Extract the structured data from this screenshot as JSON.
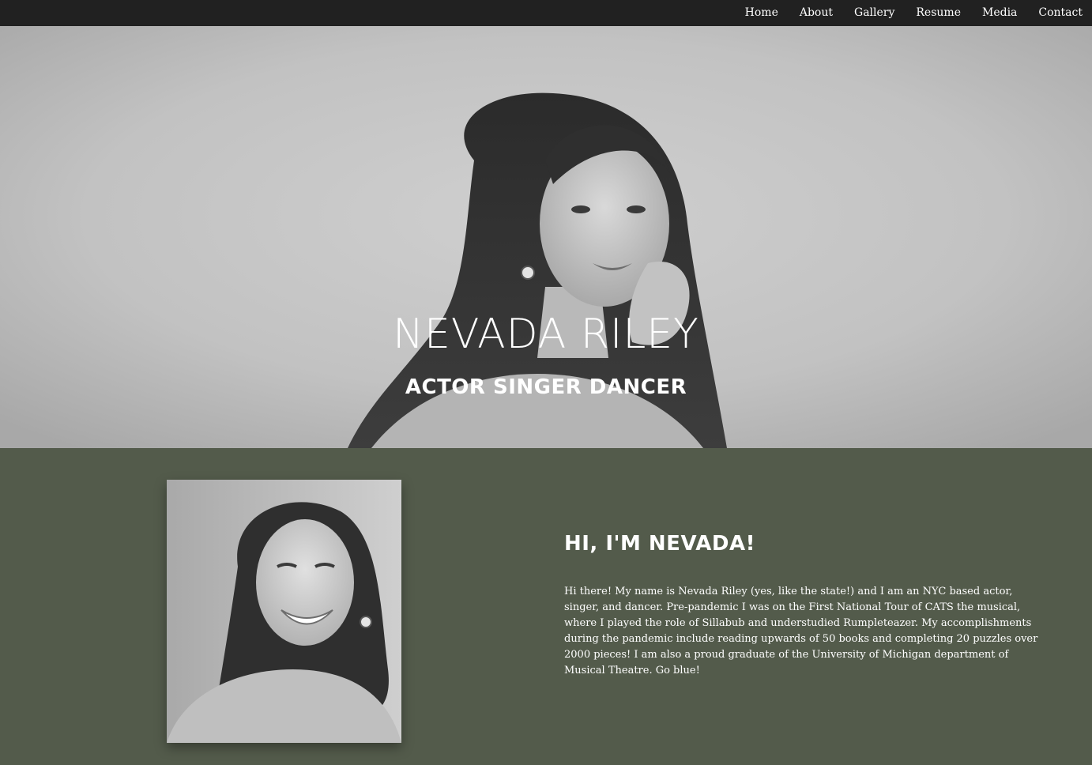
{
  "nav": {
    "items": [
      {
        "label": "Home"
      },
      {
        "label": "About"
      },
      {
        "label": "Gallery"
      },
      {
        "label": "Resume"
      },
      {
        "label": "Media"
      },
      {
        "label": "Contact"
      }
    ]
  },
  "hero": {
    "title": "NEVADA RILEY",
    "subtitle": "ACTOR SINGER DANCER"
  },
  "about": {
    "heading": "HI, I'M NEVADA!",
    "body": "Hi there! My name is Nevada Riley (yes, like the state!) and I am an NYC based actor, singer, and dancer. Pre-pandemic I was on the First National Tour of CATS the musical, where I played the role of Sillabub and understudied Rumpleteazer. My accomplishments during the pandemic include reading upwards of 50 books and completing 20 puzzles over 2000 pieces! I am also a proud graduate of the University of Michigan department of Musical Theatre. Go blue!"
  },
  "colors": {
    "navbar": "#212121",
    "about_background": "#535b4b",
    "text": "#ffffff"
  }
}
